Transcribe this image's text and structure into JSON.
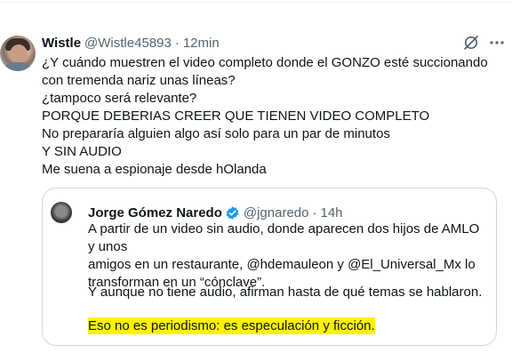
{
  "tweet": {
    "author_name": "Wistle",
    "author_handle": "@Wistle45893",
    "separator": "·",
    "time": "12min",
    "lines": [
      "¿Y cuándo muestren el video completo donde el GONZO esté succionando",
      "con tremenda nariz unas líneas?",
      "¿tampoco será relevante?",
      "PORQUE DEBERIAS CREER QUE TIENEN VIDEO COMPLETO",
      "No prepararía alguien algo así solo para un par de minutos",
      "Y SIN AUDIO",
      "Me suena a espionaje desde hOlanda"
    ]
  },
  "quoted": {
    "author_name": "Jorge Gómez Naredo",
    "author_handle": "@jgnaredo",
    "separator": "·",
    "time": "14h",
    "para1_lines": [
      "A partir de un video sin audio, donde aparecen dos hijos de AMLO y unos",
      "amigos en un restaurante, @hdemauleon y @El_Universal_Mx lo",
      "transforman en un “cónclave”."
    ],
    "para2": "Y aunque no tiene audio, afirman hasta de qué temas se hablaron.",
    "para3": "Eso no es periodismo: es especulación y ficción."
  },
  "icons": {
    "grok": "grok-icon",
    "more": "more-options-icon",
    "verified": "verified-badge-icon"
  },
  "colors": {
    "text": "#0f1419",
    "secondary": "#536471",
    "verified_blue": "#1d9bf0",
    "highlight": "#fff200",
    "border": "#cfd9de"
  }
}
